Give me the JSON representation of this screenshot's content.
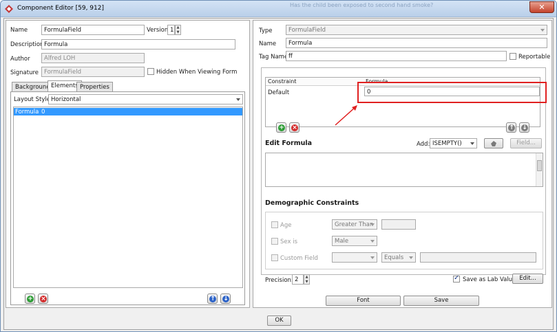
{
  "window": {
    "title": "Component Editor [59, 912]",
    "background_hint": "Has the child been exposed to second hand smoke?",
    "close_label": "✕"
  },
  "left": {
    "name_label": "Name",
    "name_value": "FormulaField",
    "version_label": "Version",
    "version_value": "1",
    "description_label": "Description",
    "description_value": "Formula",
    "author_label": "Author",
    "author_value": "Alfred LOH",
    "signature_label": "Signature",
    "signature_value": "FormulaField",
    "hidden_label": "Hidden When Viewing Form",
    "tabs": [
      "Background",
      "Elements",
      "Properties"
    ],
    "layout_style_label": "Layout Style",
    "layout_style_value": "Horizontal",
    "elements": [
      {
        "name": "Formula",
        "value": "0"
      }
    ]
  },
  "right": {
    "type_label": "Type",
    "type_value": "FormulaField",
    "name_label": "Name",
    "name_value": "Formula",
    "tag_label": "Tag Name",
    "tag_value": "ff",
    "reportable_label": "Reportable",
    "grid": {
      "col_constraint": "Constraint",
      "col_formula": "Formula",
      "rows": [
        {
          "constraint": "Default",
          "formula": "0"
        }
      ]
    },
    "edit_formula_label": "Edit Formula",
    "add_label": "Add:",
    "add_value": "ISEMPTY()",
    "field_button": "Field...",
    "demographic_label": "Demographic Constraints",
    "age_label": "Age",
    "age_op": "Greater Than",
    "sex_label": "Sex is",
    "sex_value": "Male",
    "custom_label": "Custom Field",
    "custom_op": "Equals",
    "precision_label": "Precision:",
    "precision_value": "2",
    "save_lab_label": "Save as Lab Value",
    "edit_button": "Edit...",
    "font_button": "Font",
    "save_button": "Save"
  },
  "ok_button": "OK",
  "colors": {
    "selection": "#3399ff",
    "annotation": "#e02020"
  }
}
